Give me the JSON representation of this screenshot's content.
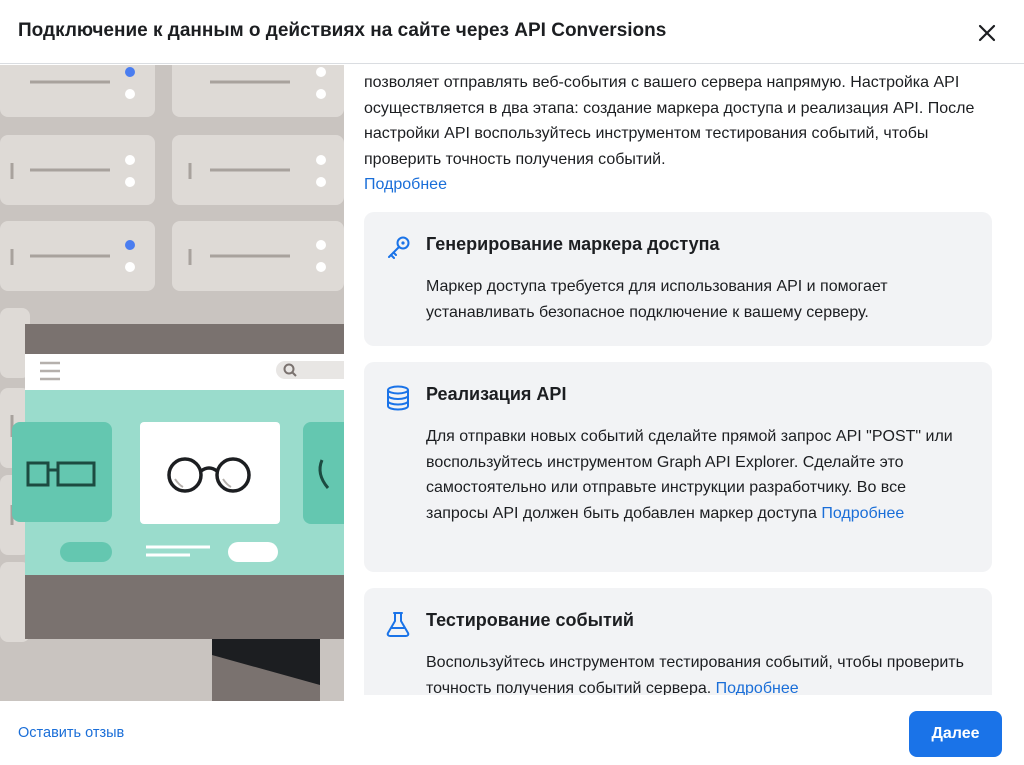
{
  "dialog": {
    "title": "Подключение к данным о действиях на сайте через API Conversions"
  },
  "intro": {
    "text": "позволяет отправлять веб-события с вашего сервера напрямую. Настройка API осуществляется в два этапа: создание маркера доступа и реализация API. После настройки API воспользуйтесь инструментом тестирования событий, чтобы проверить точность получения событий.",
    "link": "Подробнее"
  },
  "steps": [
    {
      "icon": "key-icon",
      "title": "Генерирование маркера доступа",
      "text": "Маркер доступа требуется для использования API и помогает устанавливать безопасное подключение к вашему серверу."
    },
    {
      "icon": "database-icon",
      "title": "Реализация API",
      "text": "Для отправки новых событий сделайте прямой запрос API \"POST\" или воспользуйтесь инструментом Graph API Explorer. Сделайте это самостоятельно или отправьте инструкции разработчику. Во все запросы API должен быть добавлен маркер доступа",
      "link": "Подробнее"
    },
    {
      "icon": "flask-icon",
      "title": "Тестирование событий",
      "text": "Воспользуйтесь инструментом тестирования событий, чтобы проверить точность получения событий сервера.",
      "link": "Подробнее"
    }
  ],
  "footer": {
    "feedback_label": "Оставить отзыв",
    "next_label": "Далее"
  },
  "colors": {
    "accent": "#1a73e8",
    "link": "#1a6ed8",
    "card_bg": "#f2f3f5",
    "illustration_teal": "#9adccc"
  }
}
